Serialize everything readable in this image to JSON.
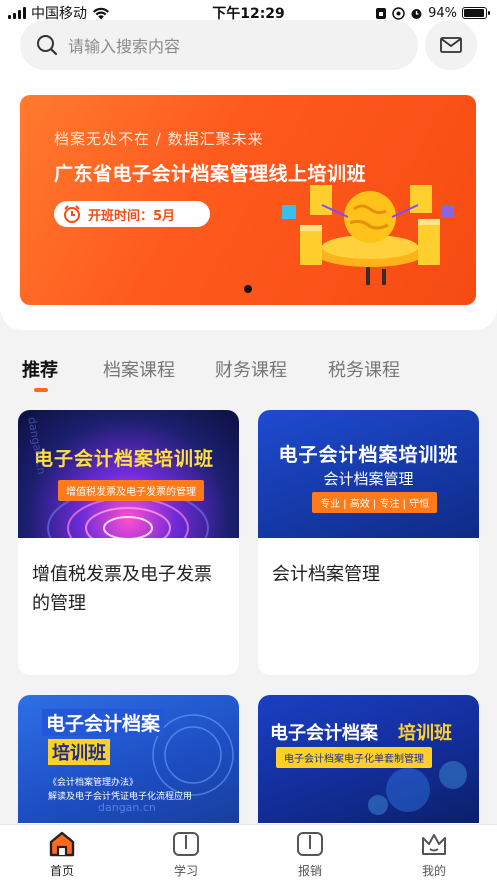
{
  "status_bar": {
    "carrier": "中国移动",
    "time": "下午12:29",
    "battery": "94%",
    "battery_level": 0.94
  },
  "search": {
    "placeholder": "请输入搜索内容"
  },
  "banner": {
    "subtitle": "档案无处不在 / 数据汇聚未来",
    "title": "广东省电子会计档案管理线上培训班",
    "pill": "开班时间：5月"
  },
  "tabs": [
    "推荐",
    "档案课程",
    "财务课程",
    "税务课程"
  ],
  "courses": [
    {
      "thumb_headline": "电子会计档案培训班",
      "thumb_strip": "增值税发票及电子发票的管理",
      "watermark": "dangan.cn",
      "title": "增值税发票及电子发票的管理"
    },
    {
      "thumb_headline": "电子会计档案培训班",
      "thumb_sub": "会计档案管理",
      "thumb_tags": "专业 | 高效 | 专注 | 守恒",
      "title": "会计档案管理"
    },
    {
      "thumb_headline": "电子会计档案",
      "thumb_badge": "培训班",
      "thumb_lines": [
        "《会计档案管理办法》",
        "解读及电子会计凭证电子化流程应用"
      ],
      "watermark": "dangan.cn",
      "title": ""
    },
    {
      "thumb_headline_a": "电子会计档案",
      "thumb_headline_b": "培训班",
      "thumb_strip": "电子会计档案电子化单套制管理",
      "title": ""
    }
  ],
  "tab_bar": {
    "items": [
      "首页",
      "学习",
      "报销",
      "我的"
    ]
  },
  "colors": {
    "accent": "#ff6a1f",
    "banner": "#f64b12"
  }
}
